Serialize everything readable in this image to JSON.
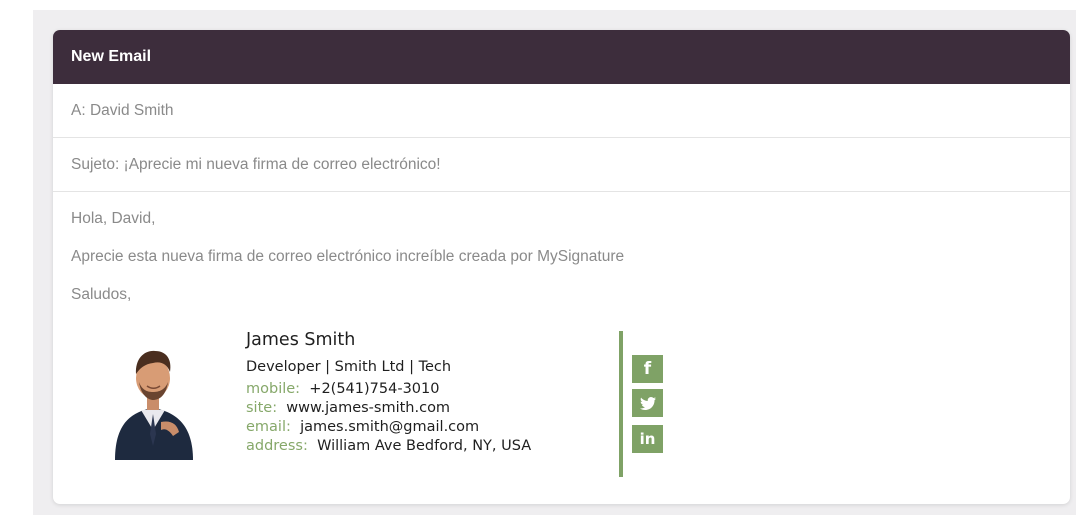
{
  "window": {
    "title": "New Email"
  },
  "fields": {
    "to": "A: David Smith",
    "subject": "Sujeto: ¡Aprecie mi nueva firma de correo electrónico!"
  },
  "body": {
    "lines": [
      "Hola, David,",
      "Aprecie esta nueva firma de correo electrónico increíble creada por MySignature",
      "Saludos,"
    ]
  },
  "signature": {
    "name": "James Smith",
    "title": "Developer | Smith Ltd | Tech",
    "rows": [
      {
        "label": "mobile:",
        "value": "+2(541)754-3010"
      },
      {
        "label": "site:",
        "value": "www.james-smith.com"
      },
      {
        "label": "email:",
        "value": "james.smith@gmail.com"
      },
      {
        "label": "address:",
        "value": "William Ave Bedford, NY, USA"
      }
    ],
    "social": [
      {
        "icon": "facebook-icon",
        "glyph": "f"
      },
      {
        "icon": "twitter-icon",
        "glyph": ""
      },
      {
        "icon": "linkedin-icon",
        "glyph": "in"
      }
    ]
  },
  "colors": {
    "header_bg": "#3d2d3c",
    "accent_green": "#7fa266",
    "muted_text": "#8a8a8a"
  }
}
